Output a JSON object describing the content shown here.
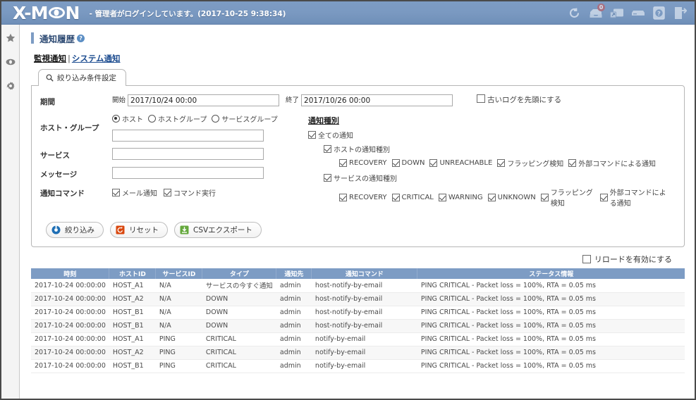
{
  "header": {
    "logo_x": "X-M",
    "logo_n": "N",
    "login_status": "-  管理者がログインしています。(2017-10-25 9:38:34)",
    "icons": [
      {
        "name": "refresh-icon",
        "label": "refresh"
      },
      {
        "name": "mail-icon",
        "label": "mail",
        "badge": "0"
      },
      {
        "name": "popup-window-icon",
        "label": "popup"
      },
      {
        "name": "server-icon",
        "label": "server"
      },
      {
        "name": "help-icon",
        "label": "help"
      },
      {
        "name": "logout-icon",
        "label": "logout"
      }
    ]
  },
  "sidebar": {
    "items": [
      {
        "name": "sidebar-item-favorites",
        "icon": "star-icon"
      },
      {
        "name": "sidebar-item-monitoring",
        "icon": "eye-icon"
      },
      {
        "name": "sidebar-item-settings",
        "icon": "gear-icon"
      }
    ]
  },
  "page": {
    "title": "通知履歴",
    "help_glyph": "?",
    "tab_current": "監視通知",
    "tab_separator": "|",
    "tab_link": "システム通知"
  },
  "filter": {
    "tab_label": "絞り込み条件設定",
    "period": {
      "label": "期間",
      "start_label": "開始",
      "start_value": "2017/10/24 00:00",
      "end_label": "終了",
      "end_value": "2017/10/26 00:00",
      "oldlog_label": "古いログを先頭にする",
      "oldlog_checked": false
    },
    "hostgroup": {
      "label": "ホスト・グループ",
      "options": [
        {
          "label": "ホスト",
          "selected": true
        },
        {
          "label": "ホストグループ",
          "selected": false
        },
        {
          "label": "サービスグループ",
          "selected": false
        }
      ],
      "value": ""
    },
    "service": {
      "label": "サービス",
      "value": ""
    },
    "message": {
      "label": "メッセージ",
      "value": ""
    },
    "notify_command": {
      "label": "通知コマンド",
      "options": [
        {
          "label": "メール通知",
          "checked": true
        },
        {
          "label": "コマンド実行",
          "checked": true
        }
      ]
    },
    "notify_type": {
      "title": "通知種別",
      "all": {
        "label": "全ての通知",
        "checked": true
      },
      "host": {
        "label": "ホストの通知種別",
        "checked": true,
        "items": [
          {
            "label": "RECOVERY",
            "checked": true
          },
          {
            "label": "DOWN",
            "checked": true
          },
          {
            "label": "UNREACHABLE",
            "checked": true
          },
          {
            "label": "フラッピング検知",
            "checked": true
          },
          {
            "label": "外部コマンドによる通知",
            "checked": true
          }
        ]
      },
      "service": {
        "label": "サービスの通知種別",
        "checked": true,
        "items": [
          {
            "label": "RECOVERY",
            "checked": true
          },
          {
            "label": "CRITICAL",
            "checked": true
          },
          {
            "label": "WARNING",
            "checked": true
          },
          {
            "label": "UNKNOWN",
            "checked": true
          },
          {
            "label": "フラッピング検知",
            "checked": true
          },
          {
            "label": "外部コマンドによる通知",
            "checked": true
          }
        ]
      }
    },
    "buttons": [
      {
        "label": "絞り込み",
        "icon": "filter-icon",
        "color": "#1f6fb5"
      },
      {
        "label": "リセット",
        "icon": "reset-icon",
        "color": "#d9480f"
      },
      {
        "label": "CSVエクスポート",
        "icon": "download-icon",
        "color": "#64a83c"
      }
    ]
  },
  "reload": {
    "label": "リロードを有効にする",
    "checked": false
  },
  "table": {
    "columns": [
      "時刻",
      "ホストID",
      "サービスID",
      "タイプ",
      "通知先",
      "通知コマンド",
      "ステータス情報"
    ],
    "rows": [
      [
        "2017-10-24 00:00:00",
        "HOST_A1",
        "N/A",
        "サービスの今すぐ通知",
        "admin",
        "host-notify-by-email",
        "PING CRITICAL - Packet loss = 100%, RTA = 0.05 ms"
      ],
      [
        "2017-10-24 00:00:00",
        "HOST_A2",
        "N/A",
        "DOWN",
        "admin",
        "host-notify-by-email",
        "PING CRITICAL - Packet loss = 100%, RTA = 0.05 ms"
      ],
      [
        "2017-10-24 00:00:00",
        "HOST_B1",
        "N/A",
        "DOWN",
        "admin",
        "host-notify-by-email",
        "PING CRITICAL - Packet loss = 100%, RTA = 0.05 ms"
      ],
      [
        "2017-10-24 00:00:00",
        "HOST_B1",
        "N/A",
        "DOWN",
        "admin",
        "host-notify-by-email",
        "PING CRITICAL - Packet loss = 100%, RTA = 0.05 ms"
      ],
      [
        "2017-10-24 00:00:00",
        "HOST_A1",
        "PING",
        "CRITICAL",
        "admin",
        "notify-by-email",
        "PING CRITICAL - Packet loss = 100%, RTA = 0.05 ms"
      ],
      [
        "2017-10-24 00:00:00",
        "HOST_A2",
        "PING",
        "CRITICAL",
        "admin",
        "notify-by-email",
        "PING CRITICAL - Packet loss = 100%, RTA = 0.05 ms"
      ],
      [
        "2017-10-24 00:00:00",
        "HOST_B1",
        "PING",
        "CRITICAL",
        "admin",
        "notify-by-email",
        "PING CRITICAL - Packet loss = 100%, RTA = 0.05 ms"
      ]
    ]
  },
  "colors": {
    "header_blue": "#7d9cc4",
    "table_header": "#7d9cc4",
    "link_blue": "#1b4b8f",
    "badge_red": "#b9626b"
  }
}
